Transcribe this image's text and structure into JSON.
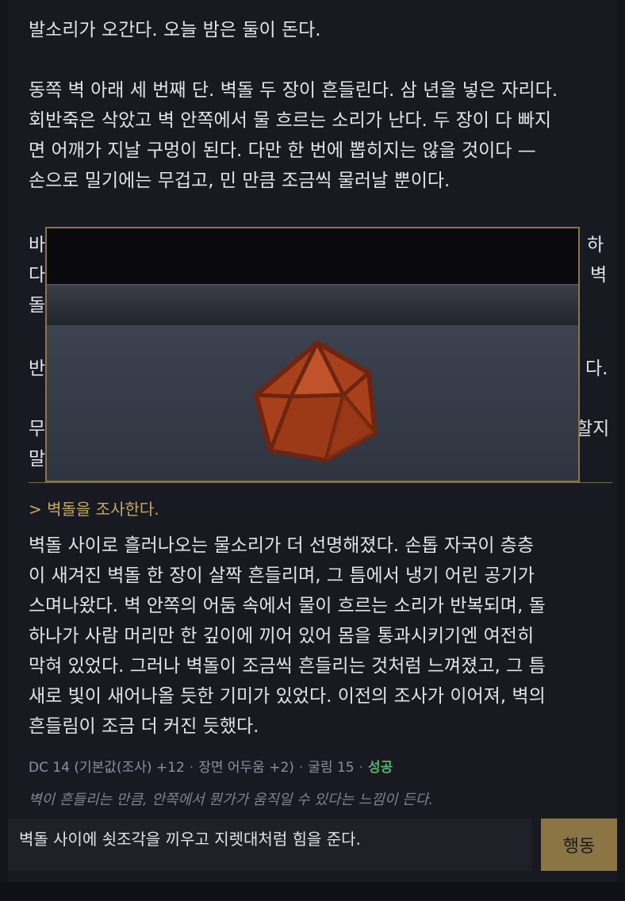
{
  "story": {
    "paragraphs": [
      "발소리가 오간다. 오늘 밤은 둘이 돈다.",
      "동쪽 벽 아래 세 번째 단. 벽돌 두 장이 흔들린다. 삼 년을 넣은 자리다.\n회반죽은 삭았고 벽 안쪽에서 물 흐르는 소리가 난다. 두 장이 다 빠지\n면 어깨가 지날 구멍이 된다. 다만 한 번에 뽑히지는 않을 것이다 —\n손으로 밀기에는 무겁고, 민 만큼 조금씩 물러날 뿐이다."
    ],
    "obscured_fragments": {
      "row1_left": "바닥",
      "row1_right": "하",
      "row2_left": "다.",
      "row2_right": "벽",
      "row3_left": "돌이",
      "row4_left": "반대",
      "row4_right": "다.",
      "row5_left": "무엇",
      "row5_right": "할지",
      "row6_left": "말하"
    }
  },
  "action_echo": "> 벽돌을 조사한다.",
  "result_text": "벽돌 사이로 흘러나오는 물소리가 더 선명해졌다. 손톱 자국이 층층\n이 새겨진 벽돌 한 장이 살짝 흔들리며, 그 틈에서 냉기 어린 공기가\n스며나왔다. 벽 안쪽의 어둠 속에서 물이 흐르는 소리가 반복되며, 돌\n하나가 사람 머리만 한 깊이에 끼어 있어 몸을 통과시키기엔 여전히\n막혀 있었다. 그러나 벽돌이 조금씩 흔들리는 것처럼 느껴졌고, 그 틈\n새로 빛이 새어나올 듯한 기미가 있었다. 이전의 조사가 이어져, 벽의\n흔들림이 조금 더 커진 듯했다.",
  "check": {
    "dc": "DC 14 (기본값(조사) +12",
    "modifier": "장면 어두움 +2)",
    "roll": "굴림 15",
    "sep": "·",
    "outcome": "성공"
  },
  "flavor": "벽이 흔들리는 만큼, 안쪽에서 뭔가가 움직일 수 있다는 느낌이 든다.",
  "input": {
    "value": "벽돌 사이에 쇳조각을 끼우고 지렛대처럼 힘을 준다."
  },
  "action_button": "행동",
  "dice": {
    "type": "d20",
    "color": "#b5471f",
    "edge_color": "#7a2a12"
  },
  "colors": {
    "accent": "#8b7545",
    "success": "#5fae6a",
    "echo": "#c9a866"
  }
}
